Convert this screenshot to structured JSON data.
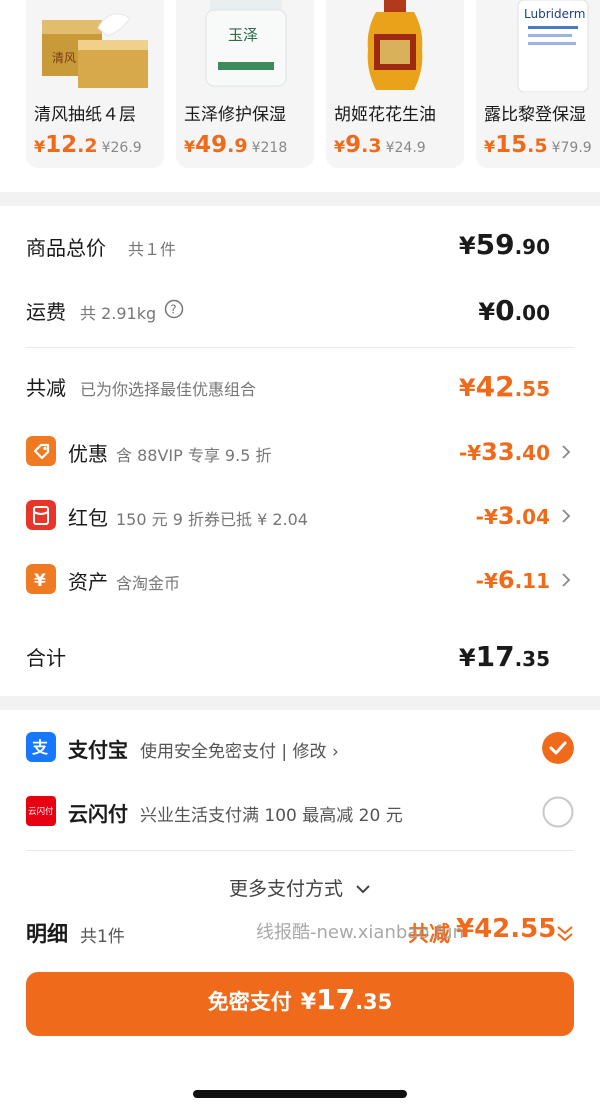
{
  "recommendations": [
    {
      "name": "清风抽纸４层",
      "price_symbol": "¥",
      "price_int": "12",
      "price_dec": ".2",
      "old_price": "¥26.9",
      "icon": "tissue-box-product-image"
    },
    {
      "name": "玉泽修护保湿",
      "price_symbol": "¥",
      "price_int": "49",
      "price_dec": ".9",
      "old_price": "¥218",
      "icon": "cream-jar-product-image",
      "brand_text": "玉泽"
    },
    {
      "name": "胡姬花花生油",
      "price_symbol": "¥",
      "price_int": "9",
      "price_dec": ".3",
      "old_price": "¥24.9",
      "icon": "oil-bottle-product-image"
    },
    {
      "name": "露比黎登保湿",
      "price_symbol": "¥",
      "price_int": "15",
      "price_dec": ".5",
      "old_price": "¥79.9",
      "icon": "lotion-bottle-product-image",
      "brand_text": "Lubriderm"
    }
  ],
  "summary": {
    "subtotal": {
      "label": "商品总价",
      "sub": "共１件",
      "yen": "¥",
      "int": "59",
      "dec": ".90"
    },
    "shipping": {
      "label": "运费",
      "sub": "共 2.91kg",
      "yen": "¥",
      "int": "0",
      "dec": ".00",
      "help_icon": "question-circle-icon"
    },
    "total_discount": {
      "label": "共减",
      "sub": "已为你选择最佳优惠组合",
      "yen": "¥",
      "int": "42",
      "dec": ".55"
    },
    "discount": {
      "label": "优惠",
      "sub": "含 88VIP 专享 9.5 折",
      "prefix": "-¥",
      "int": "33",
      "dec": ".40",
      "icon": "tag-icon"
    },
    "red_packet": {
      "label": "红包",
      "sub": "150 元 9 折券已抵 ¥ 2.04",
      "prefix": "-¥",
      "int": "3",
      "dec": ".04",
      "icon": "red-packet-icon"
    },
    "assets": {
      "label": "资产",
      "sub": "含淘金币",
      "prefix": "-¥",
      "int": "6",
      "dec": ".11",
      "icon": "yen-coin-icon"
    },
    "total": {
      "label": "合计",
      "yen": "¥",
      "int": "17",
      "dec": ".35"
    }
  },
  "payment": {
    "alipay": {
      "name": "支付宝",
      "desc": "使用安全免密支付 | 修改 ›",
      "selected": true,
      "icon": "alipay-icon"
    },
    "unionpay": {
      "name": "云闪付",
      "desc": "兴业生活支付满 100 最高减 20 元",
      "selected": false,
      "icon": "unionpay-quickpass-icon",
      "icon_text": "云闪付"
    },
    "more": "更多支付方式"
  },
  "bottom": {
    "detail_label": "明细",
    "detail_sub": "共1件",
    "total_discount_label": "共减",
    "total_discount_value": "¥42.55",
    "pay_button_label": "免密支付",
    "pay_button_yen": "¥",
    "pay_button_int": "17",
    "pay_button_dec": ".35",
    "watermark": "线报酷-new.xianbao.fun"
  },
  "colors": {
    "accent": "#f06a1c",
    "alipay_blue": "#1677ff",
    "unionpay_red": "#e60012"
  }
}
